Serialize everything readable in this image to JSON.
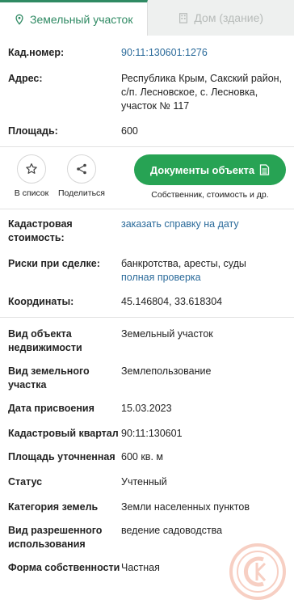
{
  "tabs": [
    {
      "label": "Земельный участок",
      "icon": "map-pin-icon",
      "active": true
    },
    {
      "label": "Дом (здание)",
      "icon": "building-icon",
      "active": false
    }
  ],
  "details_top": [
    {
      "label": "Кад.номер:",
      "value": "90:11:130601:1276",
      "link": true
    },
    {
      "label": "Адрес:",
      "value": "Республика Крым, Сакский район, с/п. Лесновское, с. Лесновка, участок № 117",
      "link": false
    },
    {
      "label": "Площадь:",
      "value": "600",
      "link": false
    }
  ],
  "actions": {
    "add_to_list": "В список",
    "share": "Поделиться",
    "documents_button": "Документы объекта",
    "documents_sub": "Собственник, стоимость и др."
  },
  "cadastral": {
    "label": "Кадастровая стоимость:",
    "link": "заказать справку на дату"
  },
  "risks": {
    "label": "Риски при сделке:",
    "value": "банкротства, аресты, суды",
    "link": "полная проверка"
  },
  "coords": {
    "label": "Координаты:",
    "value": "45.146804, 33.618304"
  },
  "details_bottom": [
    {
      "label": "Вид объекта недвижимости",
      "value": "Земельный участок"
    },
    {
      "label": "Вид земельного участка",
      "value": "Землепользование"
    },
    {
      "label": "Дата присвоения",
      "value": "15.03.2023"
    },
    {
      "label": "Кадастровый квартал",
      "value": "90:11:130601"
    },
    {
      "label": "Площадь уточненная",
      "value": "600 кв. м"
    },
    {
      "label": "Статус",
      "value": "Учтенный"
    },
    {
      "label": "Категория земель",
      "value": "Земли населенных пунктов"
    },
    {
      "label": "Вид разрешенного использования",
      "value": "ведение садоводства"
    },
    {
      "label": "Форма собственности",
      "value": "Частная"
    }
  ],
  "colors": {
    "accent": "#2f8a63",
    "button": "#27a354",
    "link": "#2a6a9a",
    "watermark": "#e3572b"
  }
}
